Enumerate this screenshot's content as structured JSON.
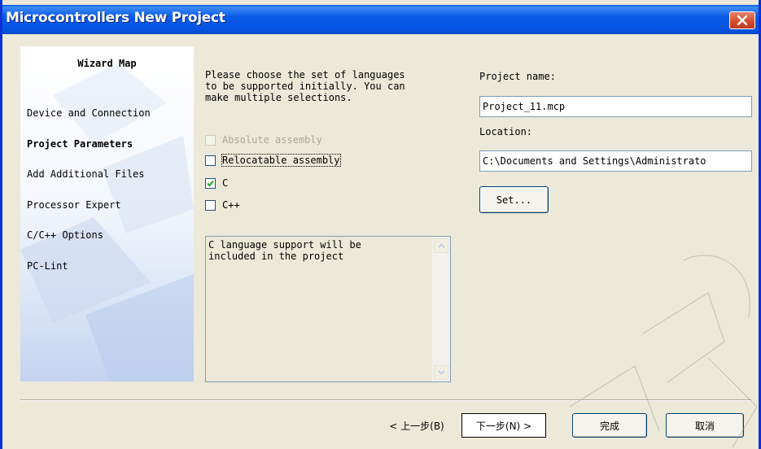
{
  "window": {
    "title": "Microcontrollers New Project"
  },
  "wizard_map": {
    "title": "Wizard Map",
    "items": [
      {
        "label": "Device and Connection",
        "active": false
      },
      {
        "label": "Project Parameters",
        "active": true
      },
      {
        "label": "Add Additional Files",
        "active": false
      },
      {
        "label": "Processor Expert",
        "active": false
      },
      {
        "label": "C/C++ Options",
        "active": false
      },
      {
        "label": "PC-Lint",
        "active": false
      }
    ]
  },
  "languages": {
    "prompt": "Please choose the set of languages\nto be supported initially. You can\nmake multiple selections.",
    "options": [
      {
        "label": "Absolute assembly",
        "checked": false,
        "disabled": true
      },
      {
        "label": "Relocatable assembly",
        "checked": false,
        "disabled": false
      },
      {
        "label": "C",
        "checked": true,
        "disabled": false
      },
      {
        "label": "C++",
        "checked": false,
        "disabled": false
      }
    ],
    "description": "C language support will be\nincluded in the project"
  },
  "project": {
    "name_label": "Project name:",
    "name_value": "Project_11.mcp",
    "location_label": "Location:",
    "location_value": "C:\\Documents and Settings\\Administrato",
    "set_button": "Set..."
  },
  "footer": {
    "back_button": "< 上一步(B)",
    "next_button": "下一步(N) >",
    "finish_button": "完成",
    "cancel_button": "取消"
  },
  "colors": {
    "titlebar": "#0553e2",
    "window_bg": "#ece9d8",
    "close_button": "#d24a2a"
  }
}
